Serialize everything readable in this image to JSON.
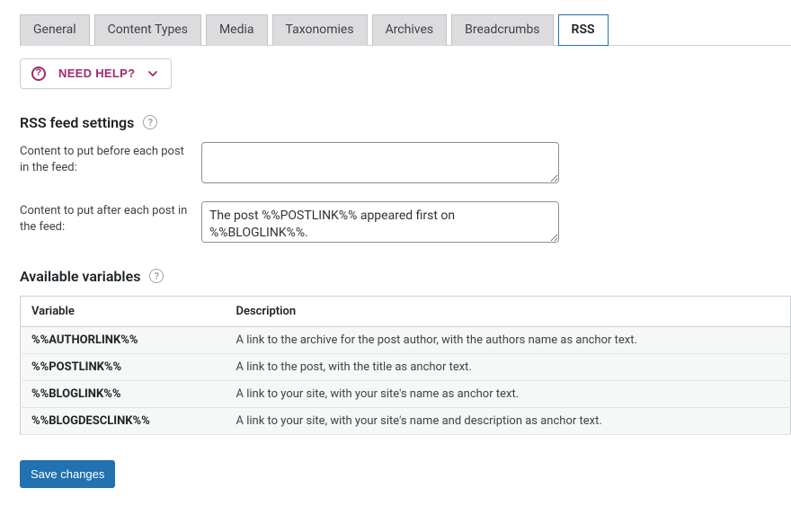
{
  "tabs": [
    {
      "label": "General",
      "active": false
    },
    {
      "label": "Content Types",
      "active": false
    },
    {
      "label": "Media",
      "active": false
    },
    {
      "label": "Taxonomies",
      "active": false
    },
    {
      "label": "Archives",
      "active": false
    },
    {
      "label": "Breadcrumbs",
      "active": false
    },
    {
      "label": "RSS",
      "active": true
    }
  ],
  "help": {
    "label": "NEED HELP?"
  },
  "section1": {
    "title": "RSS feed settings"
  },
  "fields": {
    "before": {
      "label": "Content to put before each post in the feed:",
      "value": ""
    },
    "after": {
      "label": "Content to put after each post in the feed:",
      "value": "The post %%POSTLINK%% appeared first on %%BLOGLINK%%."
    }
  },
  "section2": {
    "title": "Available variables"
  },
  "table": {
    "headers": {
      "var": "Variable",
      "desc": "Description"
    },
    "rows": [
      {
        "var": "%%AUTHORLINK%%",
        "desc": "A link to the archive for the post author, with the authors name as anchor text."
      },
      {
        "var": "%%POSTLINK%%",
        "desc": "A link to the post, with the title as anchor text."
      },
      {
        "var": "%%BLOGLINK%%",
        "desc": "A link to your site, with your site's name as anchor text."
      },
      {
        "var": "%%BLOGDESCLINK%%",
        "desc": "A link to your site, with your site's name and description as anchor text."
      }
    ]
  },
  "save": {
    "label": "Save changes"
  }
}
